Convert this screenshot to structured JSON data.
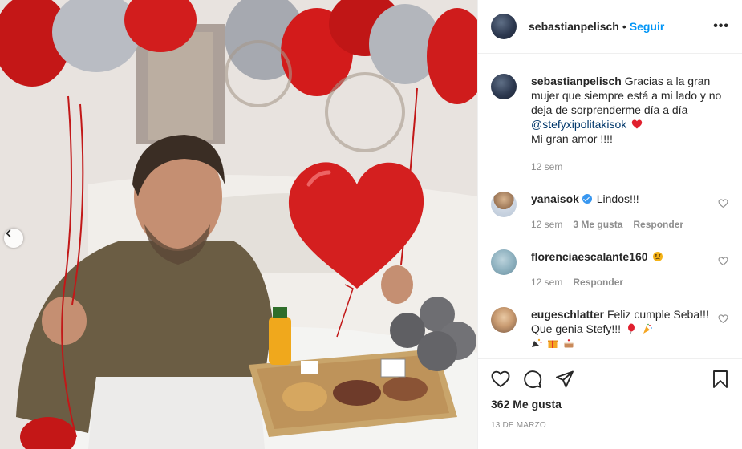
{
  "post": {
    "username": "sebastianpelisch",
    "follow_label": "Seguir",
    "separator": "•",
    "more_label": "•••"
  },
  "caption": {
    "username": "sebastianpelisch",
    "text": "Gracias a la gran mujer que siempre está a mi lado y no deja de sorprenderme día a día",
    "mention": "@stefyxipolitakisok",
    "line2": "Mi gran amor !!!!",
    "time": "12 sem"
  },
  "comments": [
    {
      "username": "yanaisok",
      "verified": true,
      "text": "Lindos!!!",
      "time": "12 sem",
      "likes": "3 Me gusta",
      "reply": "Responder"
    },
    {
      "username": "florenciaescalante160",
      "text": "",
      "time": "12 sem",
      "reply": "Responder"
    },
    {
      "username": "eugeschlatter",
      "text": "Feliz cumple Seba!!! Que genia Stefy!!!"
    }
  ],
  "stats": {
    "likes": "362 Me gusta",
    "date": "13 DE MARZO"
  },
  "colors": {
    "accent": "#0095f6",
    "mention": "#00376b",
    "heart": "#ed4956",
    "balloon": "#d41f1f"
  },
  "icons": [
    "chevron-left-icon",
    "more-icon",
    "heart-icon",
    "comment-icon",
    "share-icon",
    "bookmark-icon",
    "verified-icon"
  ]
}
